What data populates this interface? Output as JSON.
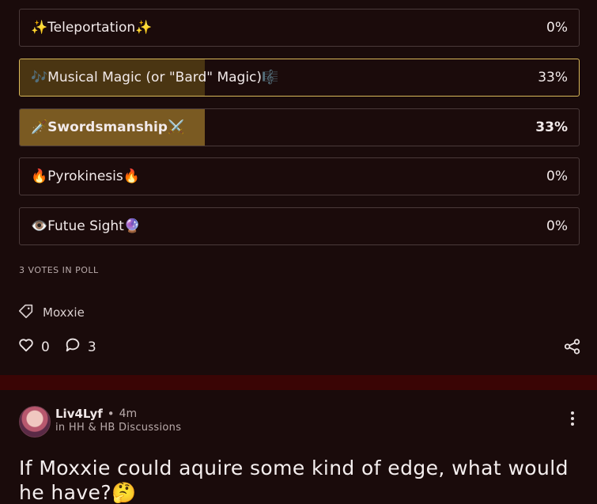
{
  "poll": {
    "options": [
      {
        "label": "✨Teleportation✨",
        "percent": "0%",
        "fill": 0
      },
      {
        "label": "🎶Musical Magic (or \"Bard\" Magic)🎼",
        "percent": "33%",
        "fill": 0.33
      },
      {
        "label": "🗡️Swordsmanship⚔️",
        "percent": "33%",
        "fill": 0.33
      },
      {
        "label": "🔥Pyrokinesis🔥",
        "percent": "0%",
        "fill": 0
      },
      {
        "label": "👁️Futue Sight🔮",
        "percent": "0%",
        "fill": 0
      }
    ],
    "votes_text": "3 VOTES IN POLL"
  },
  "tag": {
    "label": "Moxxie"
  },
  "actions": {
    "likes": "0",
    "comments": "3"
  },
  "next_post": {
    "author": "Liv4Lyf",
    "separator": "•",
    "time": "4m",
    "community": "in HH & HB Discussions",
    "title": "If Moxxie could aquire some kind of edge, what would he have?🤔"
  },
  "colors": {
    "selected_border": "#d8b85a",
    "winner_fill": "#7a5a22",
    "divider": "#3a0505",
    "background": "#1a0b0b"
  }
}
